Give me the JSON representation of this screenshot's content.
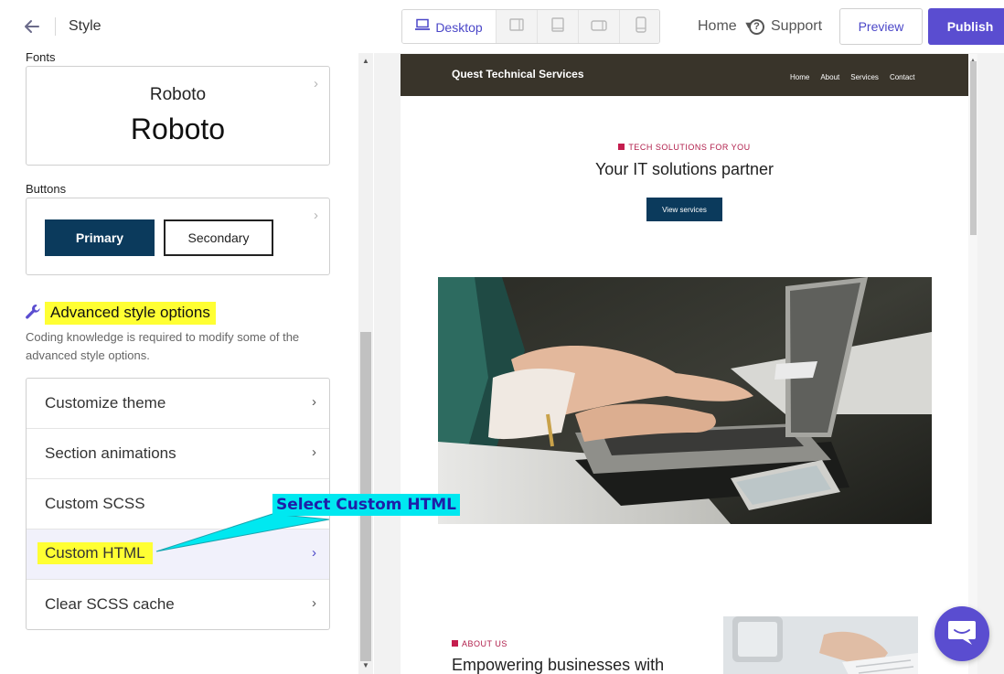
{
  "panel": {
    "title": "Style"
  },
  "fonts": {
    "label": "Fonts",
    "heading_sample": "Roboto",
    "body_sample": "Roboto"
  },
  "buttons": {
    "label": "Buttons",
    "primary": "Primary",
    "secondary": "Secondary"
  },
  "advanced": {
    "title": "Advanced style options",
    "description": "Coding knowledge is required to modify some of the advanced style options.",
    "items": [
      {
        "label": "Customize theme"
      },
      {
        "label": "Section animations"
      },
      {
        "label": "Custom SCSS"
      },
      {
        "label": "Custom HTML",
        "selected": true
      },
      {
        "label": "Clear SCSS cache"
      }
    ]
  },
  "callout": {
    "text": "Select Custom HTML",
    "bg_color": "#00e8f0",
    "text_color": "#1f1fa8"
  },
  "topbar": {
    "device": "Desktop",
    "page_select": "Home",
    "support": "Support",
    "preview": "Preview",
    "publish": "Publish"
  },
  "site": {
    "brand": "Quest Technical Services",
    "nav": [
      "Home",
      "About",
      "Services",
      "Contact"
    ],
    "hero_eyebrow": "TECH SOLUTIONS FOR YOU",
    "hero_title": "Your IT solutions partner",
    "hero_button": "View services",
    "about_eyebrow": "ABOUT US",
    "about_title": "Empowering businesses with"
  },
  "colors": {
    "accent": "#5a4dd0",
    "primary_button": "#0b3a5c",
    "site_nav": "#39342a",
    "eyebrow": "#b01d4a",
    "highlight": "#ffff33"
  }
}
